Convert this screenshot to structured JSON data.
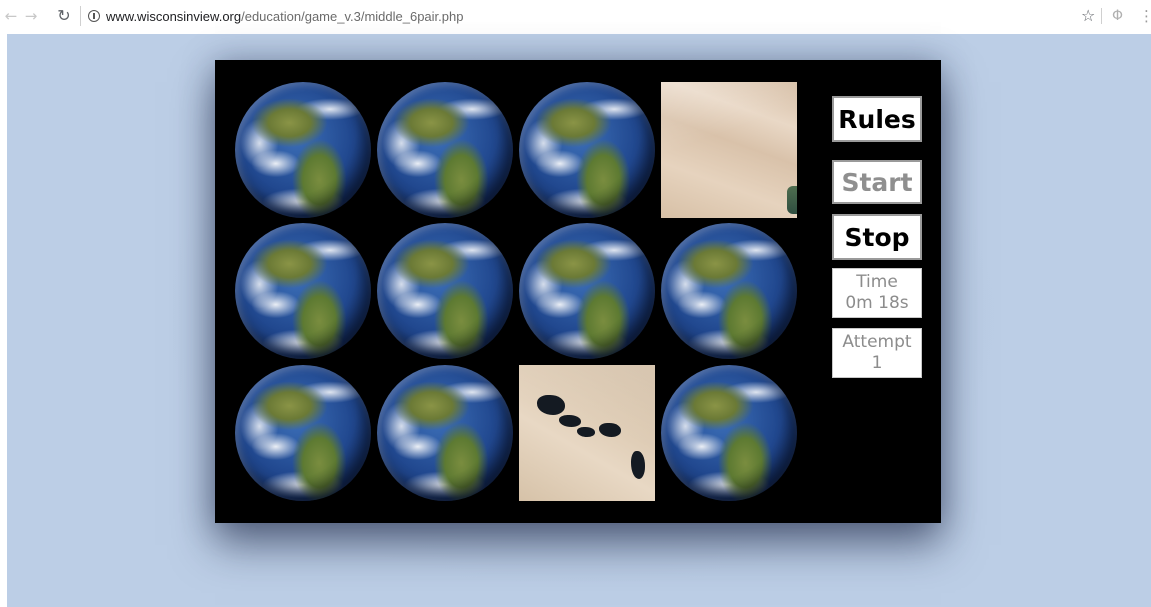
{
  "browser": {
    "url_host": "www.wisconsinview.org",
    "url_path": "/education/game_v.3/middle_6pair.php",
    "icons": [
      "back-arrow-icon",
      "forward-arrow-icon",
      "reload-icon",
      "info-icon",
      "star-icon",
      "extension-icon",
      "menu-icon"
    ]
  },
  "game": {
    "cards": [
      {
        "face": "earth"
      },
      {
        "face": "earth"
      },
      {
        "face": "earth"
      },
      {
        "face": "desert-tile"
      },
      {
        "face": "earth"
      },
      {
        "face": "earth"
      },
      {
        "face": "earth"
      },
      {
        "face": "earth"
      },
      {
        "face": "earth"
      },
      {
        "face": "earth"
      },
      {
        "face": "lake-desert-tile"
      },
      {
        "face": "earth"
      }
    ],
    "rules_label": "Rules",
    "start_label": "Start",
    "stop_label": "Stop",
    "time_label": "Time",
    "time_value": "0m 18s",
    "attempt_label": "Attempt",
    "attempt_value": "1"
  },
  "colors": {
    "page_background": "#bccee6",
    "board_background": "#000000",
    "disabled_text": "#8f8f8f"
  }
}
